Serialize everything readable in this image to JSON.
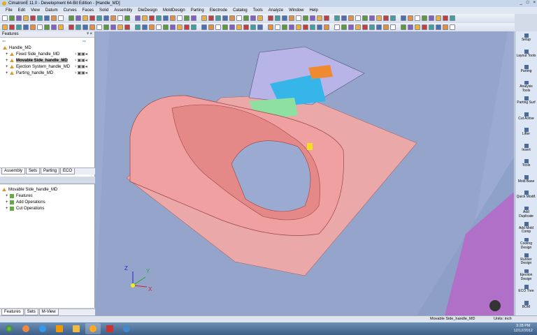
{
  "window": {
    "title": "CimatronE 11.0 - Development 64-Bit Edition - [Handle_MD]",
    "controls": [
      "_",
      "□",
      "×"
    ]
  },
  "menu": [
    "File",
    "Edit",
    "View",
    "Datum",
    "Curves",
    "Faces",
    "Solid",
    "Assembly",
    "DieDesign",
    "MoldDesign",
    "Parting",
    "Electrode",
    "Catalog",
    "Tools",
    "Analyze",
    "Window",
    "Help"
  ],
  "features_panel": {
    "title": "Features",
    "pin": "ᵠ ×",
    "items": [
      {
        "label": "Handle_MD",
        "level": 0
      },
      {
        "label": "Fixed Side_handle_MD",
        "level": 1
      },
      {
        "label": "Movable Side_handle_MD",
        "level": 1,
        "selected": true
      },
      {
        "label": "Ejection System_handle_MD",
        "level": 1
      },
      {
        "label": "Parting_handle_MD",
        "level": 1
      }
    ],
    "tabs": [
      "Assembly",
      "Sets",
      "Parting",
      "ECO"
    ]
  },
  "sub_panel": {
    "root": "Movable Side_handle_MD",
    "items": [
      "Features",
      "Add Operations",
      "Cut Operations"
    ],
    "tabs": [
      "Features",
      "Sets",
      "M-View"
    ]
  },
  "palette": [
    "Setup",
    "Layout Tools",
    "Parting",
    "Analysis Tools",
    "Parting Surf",
    "Cut Active",
    "Lifter",
    "Insert",
    "Tools",
    "Mold Base",
    "Quick Modif.",
    "Add Duplicate",
    "Add Mold Comp",
    "Cooling Design",
    "Runner Design",
    "Ejection Design",
    "ECO Tree",
    "BOM"
  ],
  "axes": {
    "x": "X",
    "y": "Y",
    "z": "Z"
  },
  "status": {
    "active": "Movable Side_handle_MD",
    "units": "Units: inch"
  },
  "taskbar": {
    "time": "3:28 PM",
    "date": "12/12/2012"
  }
}
